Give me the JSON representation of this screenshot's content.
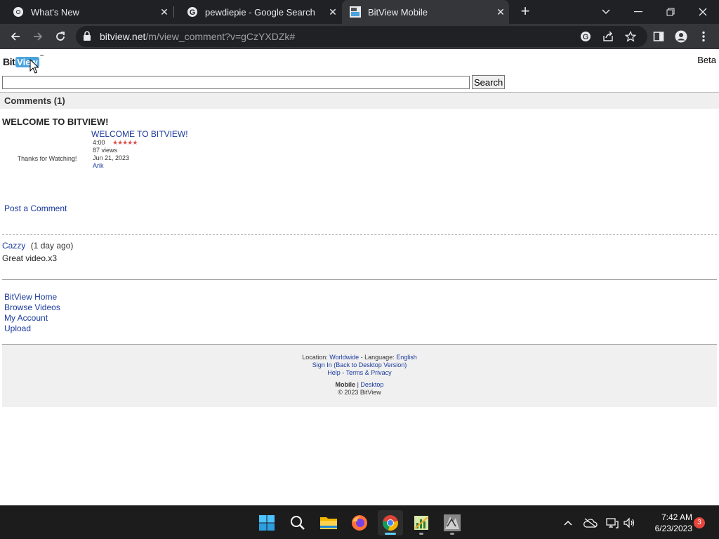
{
  "browser": {
    "tabs": [
      {
        "title": "What's New",
        "icon": "chrome-icon"
      },
      {
        "title": "pewdiepie - Google Search",
        "icon": "google-icon"
      },
      {
        "title": "BitView Mobile",
        "icon": "bitview-icon"
      }
    ],
    "url_host": "bitview.net",
    "url_path": "/m/view_comment?v=gCzYXDZk#"
  },
  "page": {
    "logo_bit": "Bit",
    "logo_view": "View",
    "logo_tm": "™",
    "beta": "Beta",
    "search_value": "",
    "search_button": "Search",
    "section_title": "Comments (1)",
    "video": {
      "heading": "WELCOME TO BITVIEW!",
      "thumb_caption": "Thanks for Watching!",
      "title": "WELCOME TO BITVIEW!",
      "duration": "4:00",
      "rating": 5,
      "stars": "★★★★★",
      "views": "87 views",
      "date": "Jun 21, 2023",
      "author": "Arik"
    },
    "post_comment": "Post a Comment",
    "comment": {
      "author": "Cazzy",
      "age": "(1 day ago)",
      "text": "Great video.x3"
    },
    "nav": [
      "BitView Home",
      "Browse Videos",
      "My Account",
      "Upload"
    ],
    "footer": {
      "location_label": "Location:",
      "location": "Worldwide",
      "language_label": "- Language:",
      "language": "English",
      "signin": "Sign In (Back to Desktop Version)",
      "help": "Help",
      "dash": "-",
      "terms": "Terms & Privacy",
      "mobile": "Mobile",
      "pipe": "|",
      "desktop": "Desktop",
      "copyright": "© 2023 BitView"
    }
  },
  "taskbar": {
    "apps": [
      "windows-start-icon",
      "search-icon",
      "file-explorer-icon",
      "firefox-icon",
      "chrome-icon",
      "spreadsheet-app-icon",
      "game-app-icon"
    ],
    "time": "7:42 AM",
    "date": "6/23/2023",
    "notifications": "3"
  },
  "colors": {
    "link": "#1a3a9c",
    "chrome_dark": "#202124",
    "chrome_toolbar": "#35363a",
    "logo_blue": "#4aa3df",
    "star_red": "#d9534f"
  }
}
